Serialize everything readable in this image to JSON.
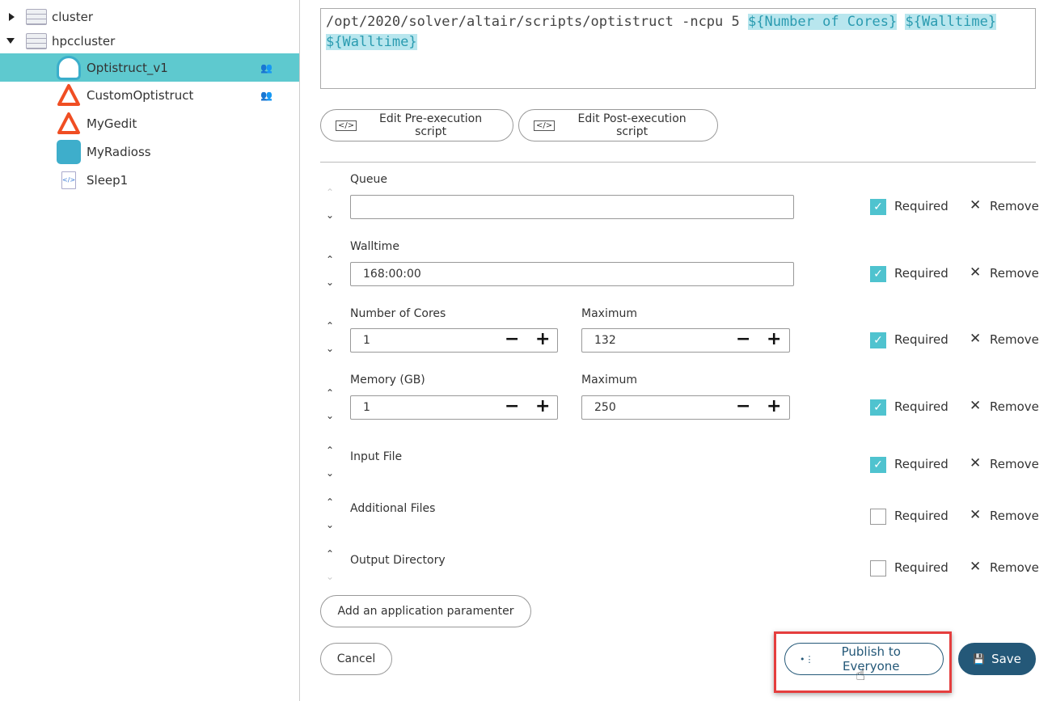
{
  "sidebar": {
    "clusters": [
      {
        "label": "cluster",
        "expanded": false
      },
      {
        "label": "hpccluster",
        "expanded": true
      }
    ],
    "apps": [
      {
        "label": "Optistruct_v1",
        "shared": true,
        "selected": true
      },
      {
        "label": "CustomOptistruct",
        "shared": true
      },
      {
        "label": "MyGedit"
      },
      {
        "label": "MyRadioss"
      },
      {
        "label": "Sleep1"
      }
    ]
  },
  "command": {
    "text": "/opt/2020/solver/altair/scripts/optistruct -ncpu 5 ",
    "vars": [
      "${Number of Cores}",
      "${Walltime}",
      "${Walltime}"
    ]
  },
  "buttons": {
    "pre": "Edit Pre-execution script",
    "post": "Edit Post-execution script",
    "add": "Add an application paramenter",
    "cancel": "Cancel",
    "publish": "Publish to Everyone",
    "save": "Save"
  },
  "params": [
    {
      "label": "Queue",
      "value": "",
      "required": true
    },
    {
      "label": "Walltime",
      "value": "168:00:00",
      "required": true
    },
    {
      "label": "Number of Cores",
      "value": "1",
      "max_label": "Maximum",
      "max": "132",
      "required": true
    },
    {
      "label": "Memory (GB)",
      "value": "1",
      "max_label": "Maximum",
      "max": "250",
      "required": true
    },
    {
      "label": "Input File",
      "required": true
    },
    {
      "label": "Additional Files",
      "required": false
    },
    {
      "label": "Output Directory",
      "required": false
    }
  ],
  "required_label": "Required",
  "remove_label": "Remove",
  "colors": {
    "selected": "#5ec9cf",
    "accent": "#4fc3cf",
    "save": "#245878",
    "highlight": "#e53e3e"
  }
}
